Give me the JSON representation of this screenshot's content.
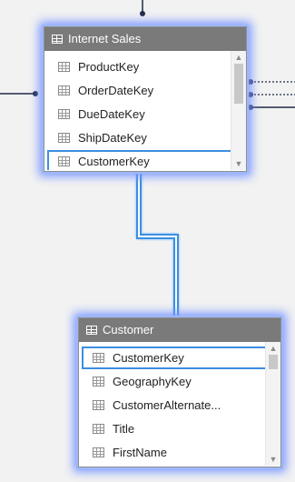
{
  "tables": [
    {
      "name": "Internet Sales",
      "fields": [
        "ProductKey",
        "OrderDateKey",
        "DueDateKey",
        "ShipDateKey",
        "CustomerKey"
      ],
      "selected_field": "CustomerKey"
    },
    {
      "name": "Customer",
      "fields": [
        "CustomerKey",
        "GeographyKey",
        "CustomerAlternate...",
        "Title",
        "FirstName"
      ],
      "selected_field": "CustomerKey"
    }
  ],
  "colors": {
    "header_bg": "#7a7a7a",
    "selection_glow": "#7b98ff",
    "relationship_line": "#3c8fe0",
    "connector": "#1f2a44"
  },
  "icons": {
    "table_header": "table-icon",
    "field": "column-icon",
    "scroll_up": "chevron-up-icon",
    "scroll_down": "chevron-down-icon"
  }
}
